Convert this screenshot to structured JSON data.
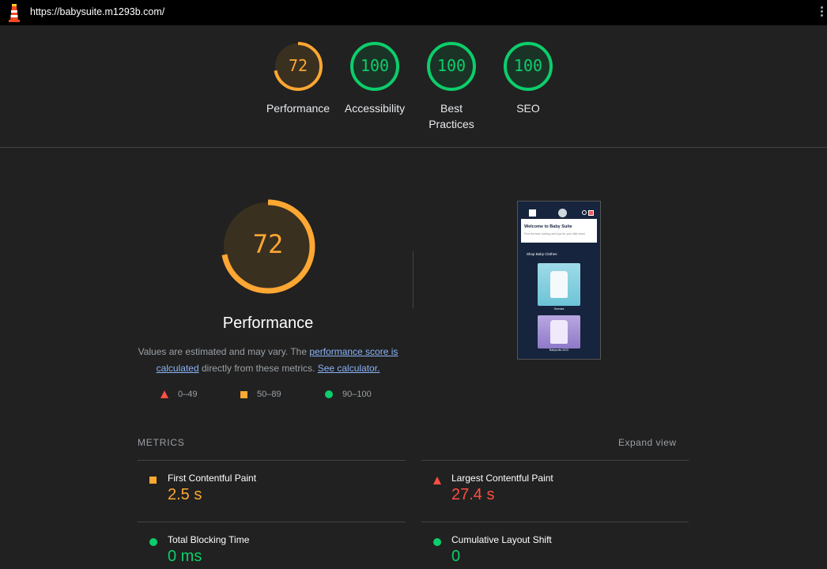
{
  "browser": {
    "url": "https://babysuite.m1293b.com/",
    "logo_icon": "lighthouse-icon",
    "menu_icon": "kebab-menu-icon"
  },
  "categories": [
    {
      "name": "Performance",
      "score": 72,
      "color": "#ffa733"
    },
    {
      "name": "Accessibility",
      "score": 100,
      "color": "#0cce6b"
    },
    {
      "name": "Best Practices",
      "score": 100,
      "color": "#0cce6b"
    },
    {
      "name": "SEO",
      "score": 100,
      "color": "#0cce6b"
    }
  ],
  "performance": {
    "score": 72,
    "title": "Performance",
    "desc_prefix": "Values are estimated and may vary. The ",
    "link_score": "performance score is calculated",
    "desc_middle": " directly from these metrics. ",
    "link_calc": "See calculator."
  },
  "legend": [
    {
      "range": "0–49",
      "shape": "triangle",
      "color": "#ff4e42"
    },
    {
      "range": "50–89",
      "shape": "square",
      "color": "#ffa733"
    },
    {
      "range": "90–100",
      "shape": "circle",
      "color": "#0cce6b"
    }
  ],
  "screenshot": {
    "hero_title": "Welcome to Baby Suite",
    "hero_sub": "Find the best clothing and toys for your little ones!",
    "section": "Shop Baby Clothes",
    "card1": "Onesies",
    "card2": "Babysuits 2023"
  },
  "metrics": {
    "header": "METRICS",
    "expand": "Expand view",
    "items": [
      {
        "label": "First Contentful Paint",
        "value": "2.5 s",
        "rating": "average"
      },
      {
        "label": "Largest Contentful Paint",
        "value": "27.4 s",
        "rating": "fail"
      },
      {
        "label": "Total Blocking Time",
        "value": "0 ms",
        "rating": "pass"
      },
      {
        "label": "Cumulative Layout Shift",
        "value": "0",
        "rating": "pass"
      }
    ]
  }
}
